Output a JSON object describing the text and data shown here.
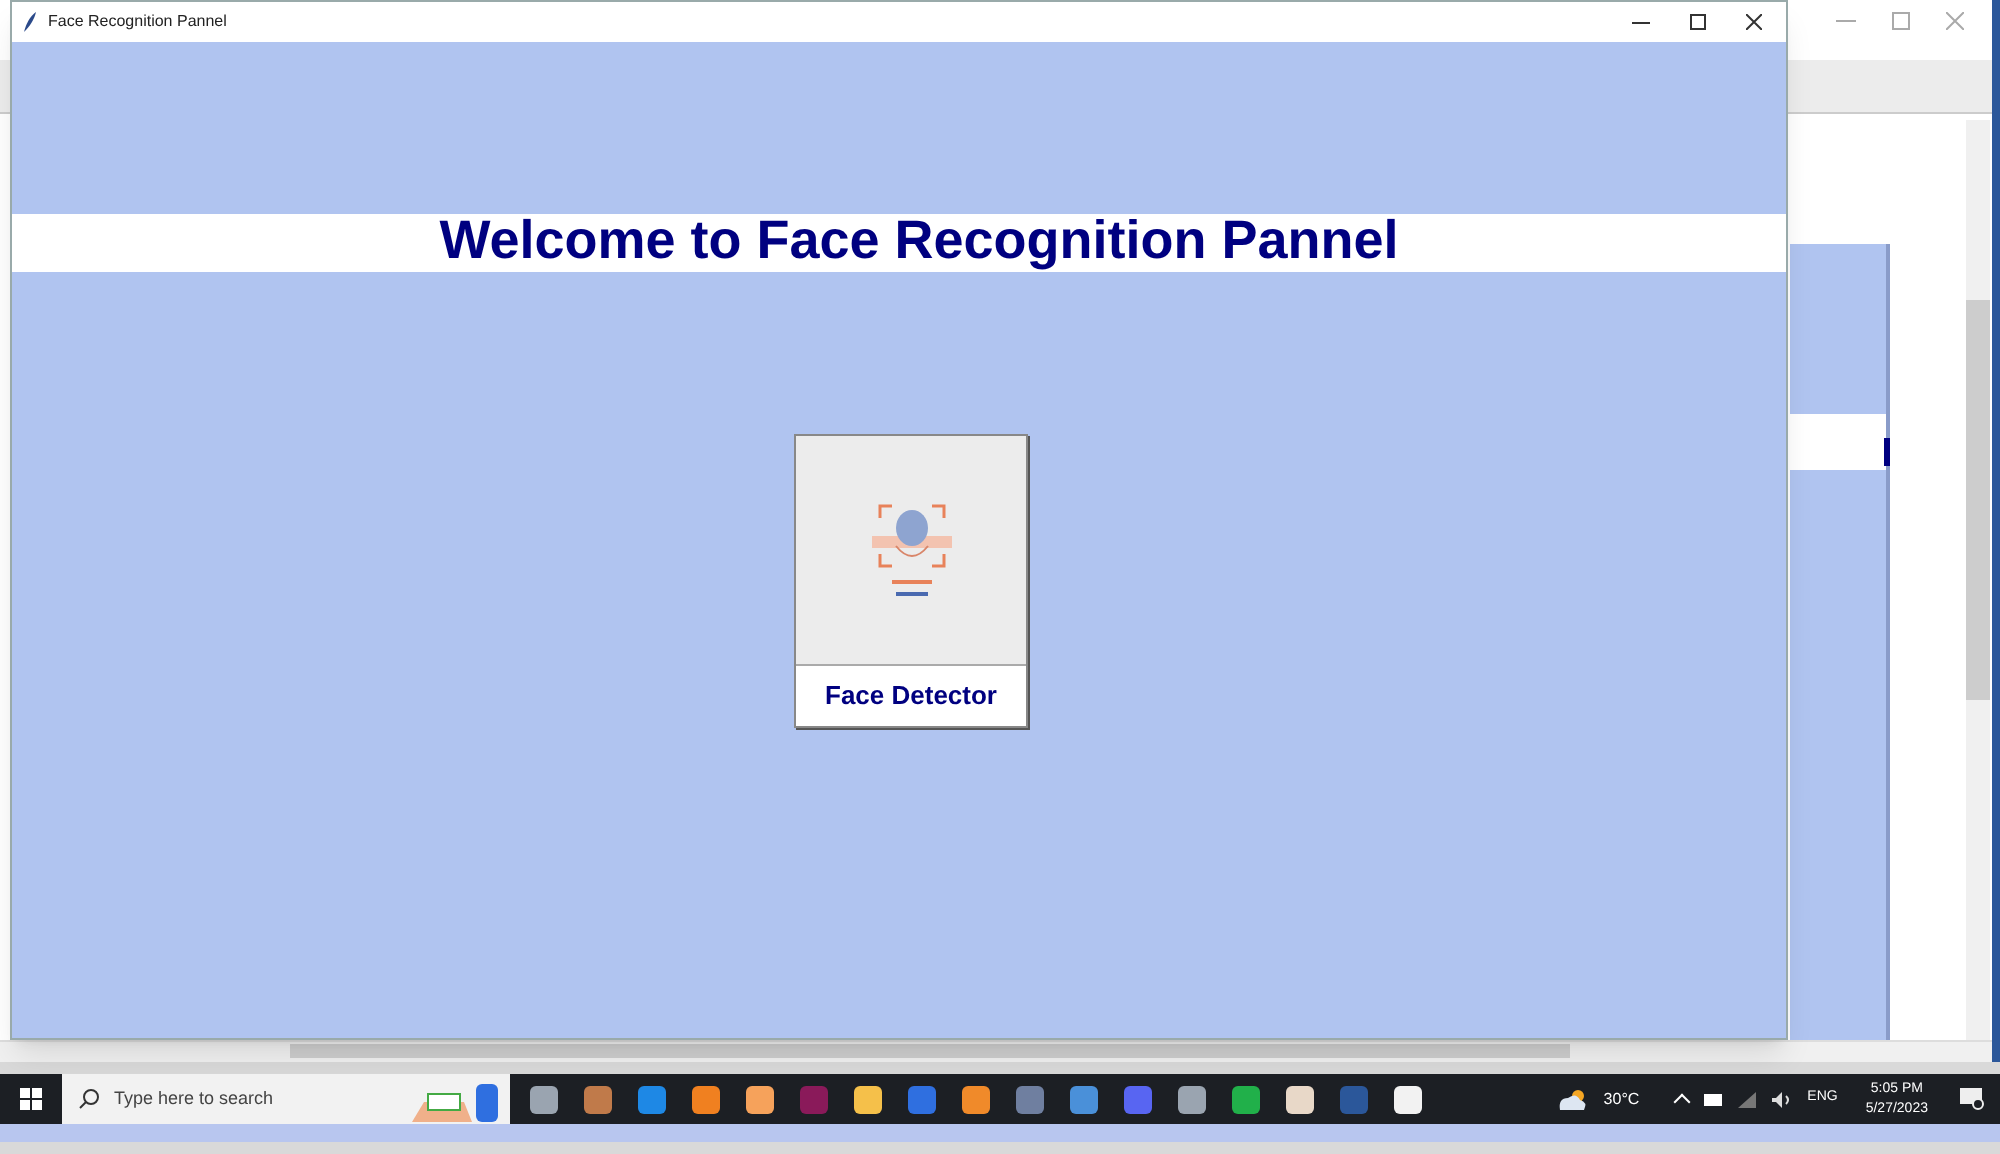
{
  "window": {
    "title": "Face Recognition Pannel"
  },
  "heading": "Welcome to Face Recognition Pannel",
  "detector_button": {
    "label": "Face Detector"
  },
  "taskbar": {
    "search": {
      "placeholder": "Type here to search"
    },
    "weather": "30°C",
    "language": "ENG",
    "time": "5:05 PM",
    "date": "5/27/2023"
  }
}
